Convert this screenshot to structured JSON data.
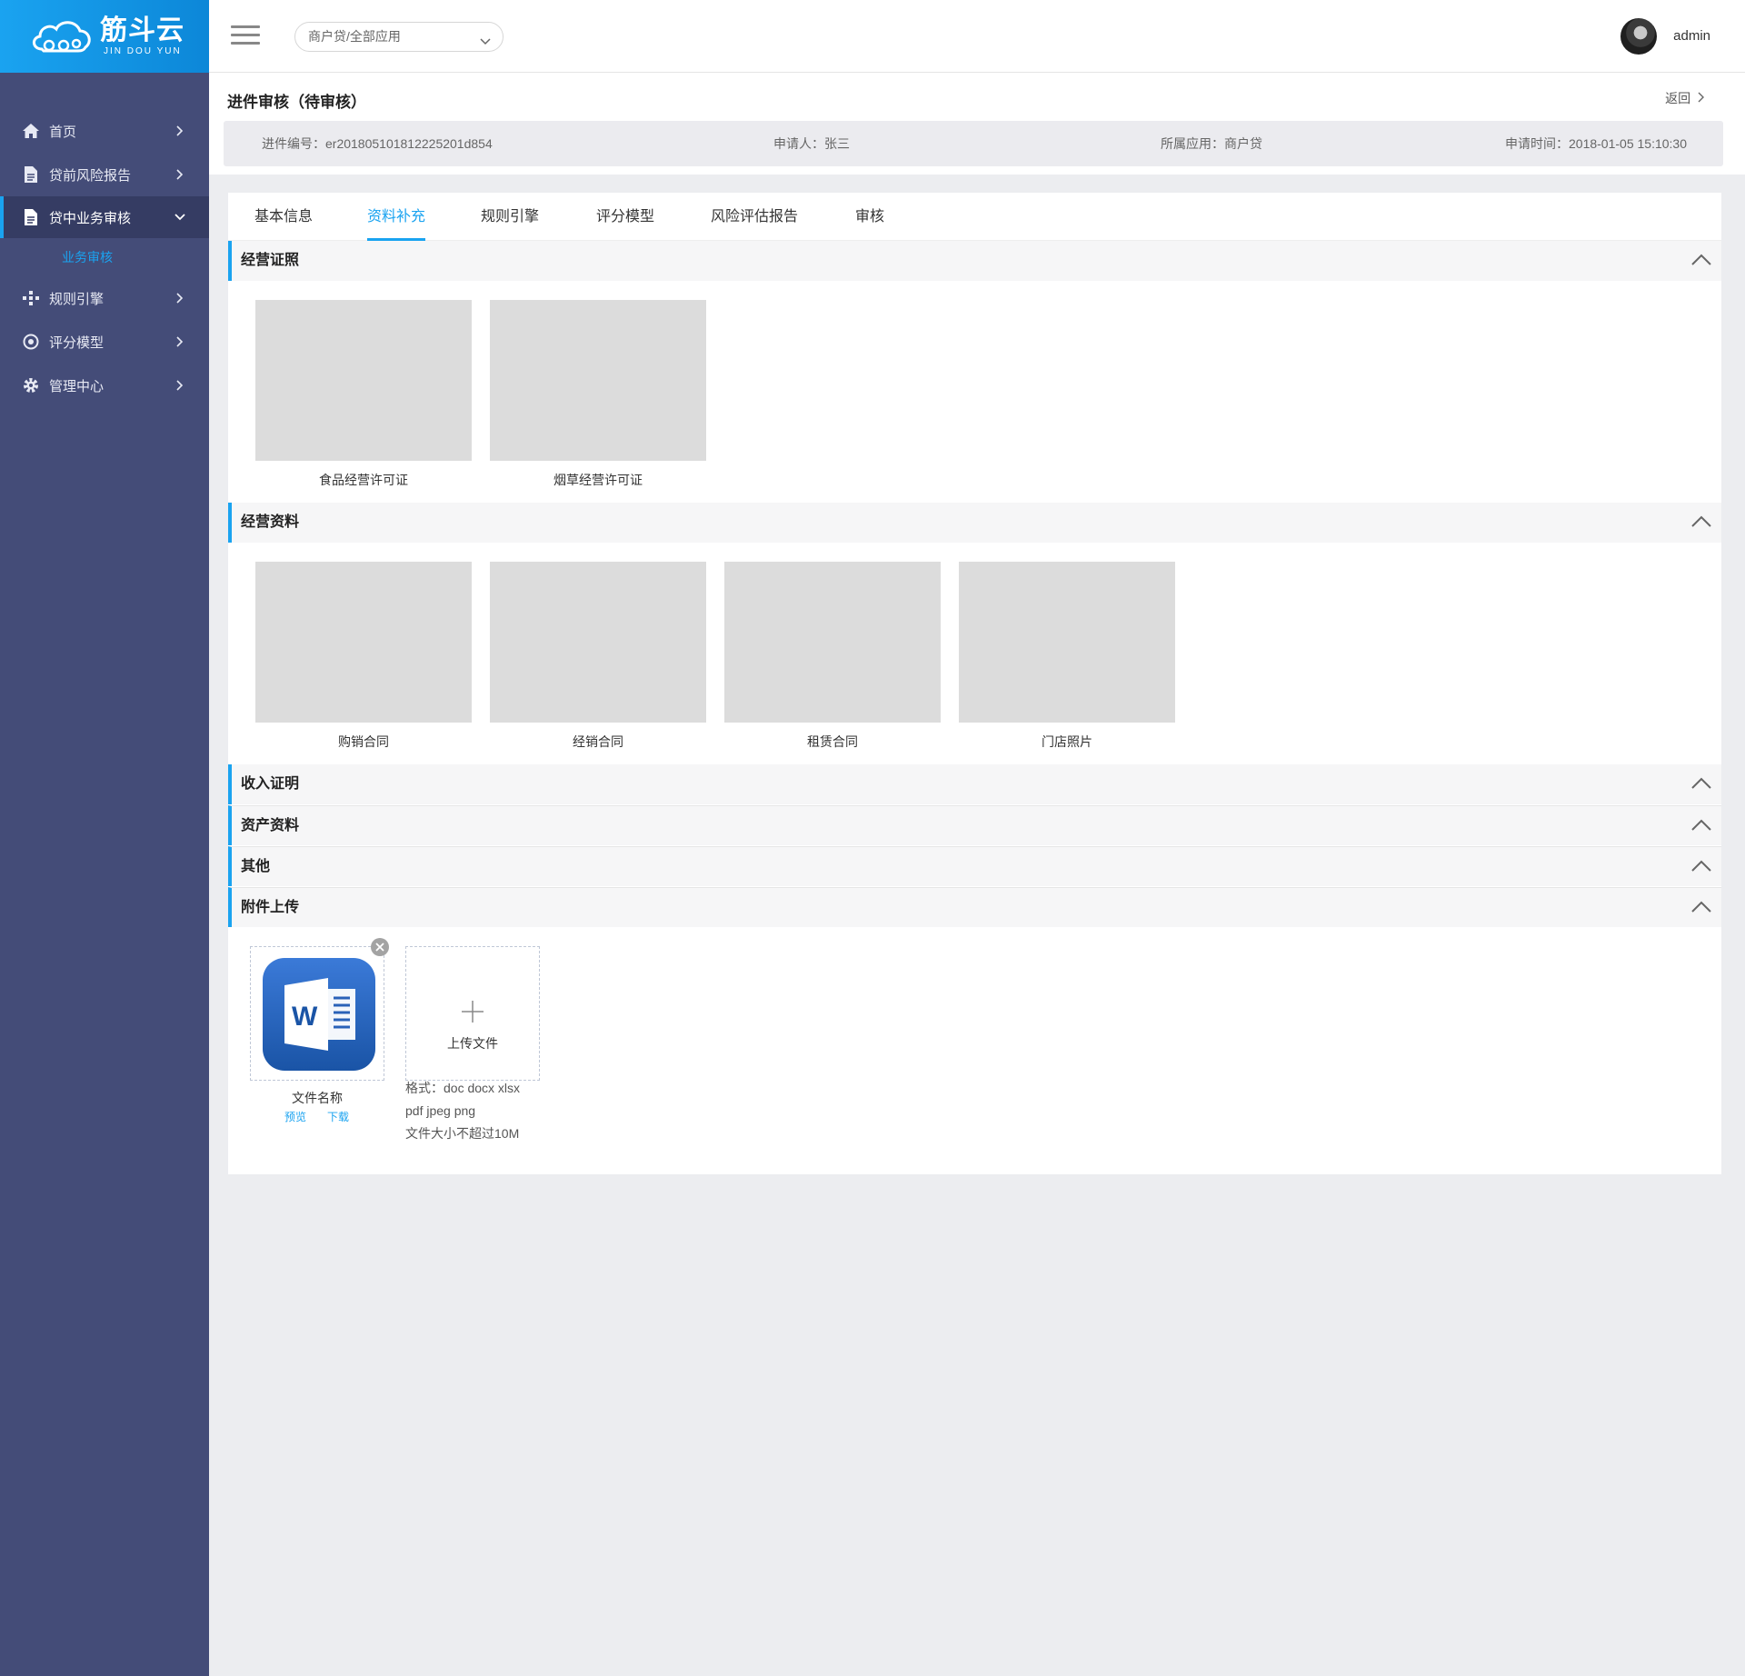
{
  "brand": {
    "name": "筋斗云",
    "sub": "JIN DOU YUN"
  },
  "sidebar": {
    "items": [
      {
        "label": "首页",
        "icon": "home-icon"
      },
      {
        "label": "贷前风险报告",
        "icon": "document-icon"
      },
      {
        "label": "贷中业务审核",
        "icon": "document-icon",
        "active": true,
        "children": [
          "业务审核"
        ]
      },
      {
        "label": "规则引擎",
        "icon": "network-icon"
      },
      {
        "label": "评分模型",
        "icon": "target-icon"
      },
      {
        "label": "管理中心",
        "icon": "gear-icon"
      }
    ]
  },
  "header": {
    "app_select": "商户贷/全部应用",
    "username": "admin"
  },
  "page": {
    "title": "进件审核（待审核）",
    "back": "返回",
    "info": {
      "case_no": "进件编号：er201805101812225201d854",
      "applicant": "申请人：张三",
      "app": "所属应用：商户贷",
      "time": "申请时间：2018-01-05 15:10:30"
    }
  },
  "tabs": [
    "基本信息",
    "资料补充",
    "规则引擎",
    "评分模型",
    "风险评估报告",
    "审核"
  ],
  "active_tab": "资料补充",
  "sections": {
    "license": {
      "title": "经营证照",
      "items": [
        "食品经营许可证",
        "烟草经营许可证"
      ]
    },
    "business": {
      "title": "经营资料",
      "items": [
        "购销合同",
        "经销合同",
        "租赁合同",
        "门店照片"
      ]
    },
    "income": {
      "title": "收入证明"
    },
    "assets": {
      "title": "资产资料"
    },
    "other": {
      "title": "其他"
    },
    "attachments": {
      "title": "附件上传",
      "file_name": "文件名称",
      "preview": "预览",
      "download": "下载",
      "upload_label": "上传文件",
      "format_line1": "格式：doc  docx  xlsx",
      "format_line2": "pdf  jpeg  png",
      "size_limit": "文件大小不超过10M"
    }
  },
  "colors": {
    "accent": "#1aa3f0",
    "sidebar": "#444c78",
    "sidebar_active": "#353c63"
  }
}
